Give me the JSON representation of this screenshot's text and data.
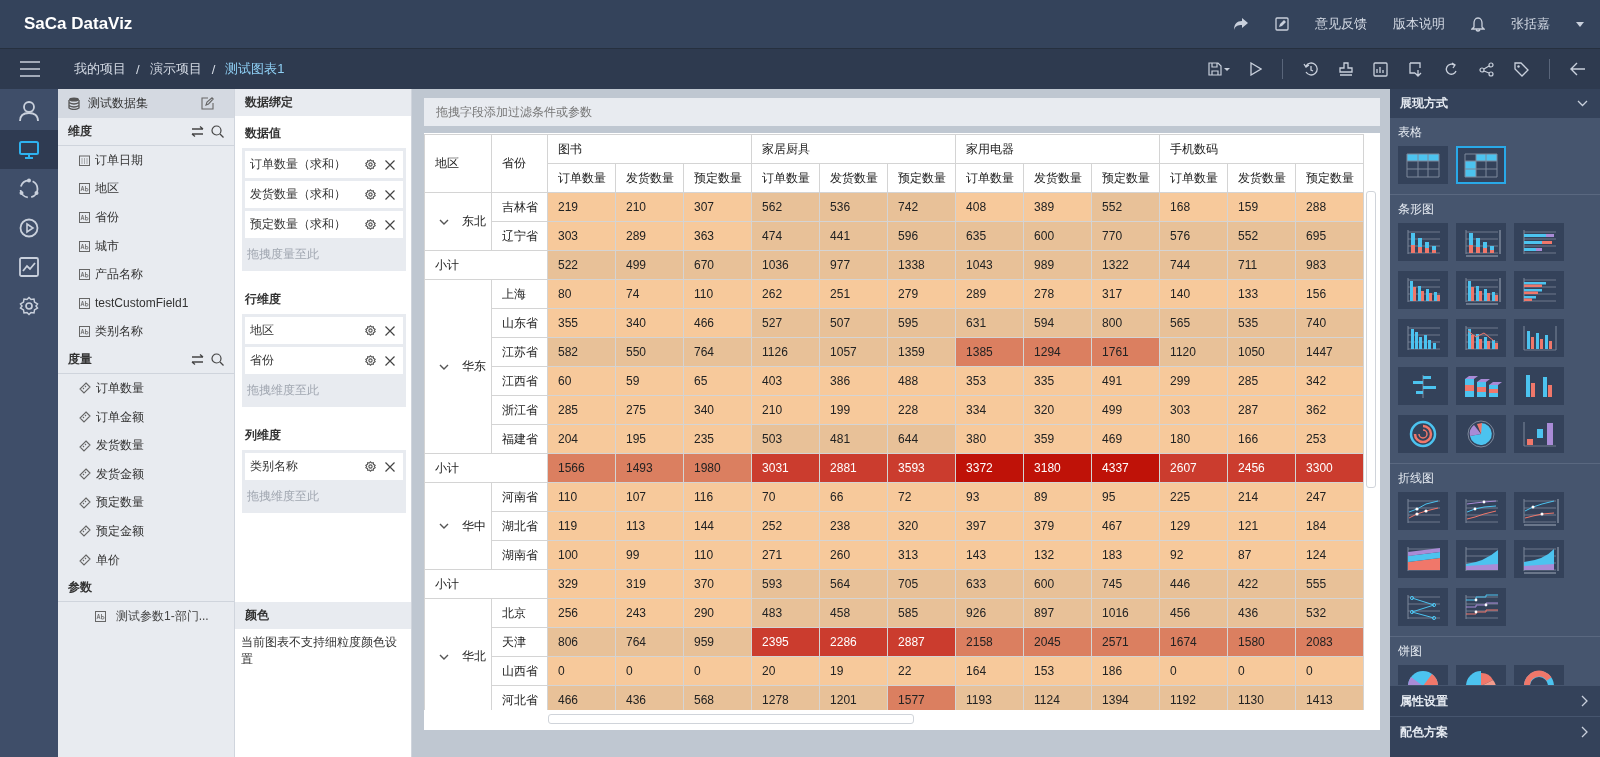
{
  "header": {
    "logo": "SaCa DataViz",
    "links": [
      "意见反馈",
      "版本说明"
    ],
    "user": "张括嘉"
  },
  "breadcrumb": {
    "separator": "/",
    "items": [
      "我的项目",
      "演示项目",
      "测试图表1"
    ]
  },
  "nav": [
    {
      "kind": "user",
      "selected": false
    },
    {
      "kind": "monitor",
      "selected": true
    },
    {
      "kind": "ring",
      "selected": false
    },
    {
      "kind": "play",
      "selected": false
    },
    {
      "kind": "chart",
      "selected": false
    },
    {
      "kind": "gear",
      "selected": false
    }
  ],
  "dataset": {
    "title": "测试数据集",
    "sections": [
      {
        "title": "维度",
        "tools": true,
        "items": [
          {
            "label": "订单日期",
            "kind": "date"
          },
          {
            "label": "地区",
            "kind": "text"
          },
          {
            "label": "省份",
            "kind": "text"
          },
          {
            "label": "城市",
            "kind": "text"
          },
          {
            "label": "产品名称",
            "kind": "text"
          },
          {
            "label": "testCustomField1",
            "kind": "text"
          },
          {
            "label": "类别名称",
            "kind": "text"
          }
        ]
      },
      {
        "title": "度量",
        "tools": true,
        "items": [
          {
            "label": "订单数量",
            "kind": "measure"
          },
          {
            "label": "订单金额",
            "kind": "measure"
          },
          {
            "label": "发货数量",
            "kind": "measure"
          },
          {
            "label": "发货金额",
            "kind": "measure"
          },
          {
            "label": "预定数量",
            "kind": "measure"
          },
          {
            "label": "预定金额",
            "kind": "measure"
          },
          {
            "label": "单价",
            "kind": "measure"
          }
        ]
      },
      {
        "title": "参数",
        "tools": false,
        "items": [
          {
            "label": "测试参数1-部门...",
            "kind": "param"
          }
        ]
      }
    ]
  },
  "binding": {
    "title": "数据绑定",
    "sections": [
      {
        "title": "数据值",
        "fields": [
          "订单数量（求和）",
          "发货数量（求和）",
          "预定数量（求和）"
        ],
        "hint": "拖拽度量至此"
      },
      {
        "title": "行维度",
        "fields": [
          "地区",
          "省份"
        ],
        "hint": "拖拽维度至此"
      },
      {
        "title": "列维度",
        "fields": [
          "类别名称"
        ],
        "hint": "拖拽维度至此"
      }
    ],
    "color": {
      "title": "颜色",
      "note": "当前图表不支持细粒度颜色设置"
    }
  },
  "filter_bar": {
    "hint": "拖拽字段添加过滤条件或参数"
  },
  "table": {
    "region_header": "地区",
    "province_header": "省份",
    "groups": [
      {
        "label": "图书",
        "measures": [
          "订单数量",
          "发货数量",
          "预定数量"
        ]
      },
      {
        "label": "家居厨具",
        "measures": [
          "订单数量",
          "发货数量",
          "预定数量"
        ]
      },
      {
        "label": "家用电器",
        "measures": [
          "订单数量",
          "发货数量",
          "预定数量"
        ]
      },
      {
        "label": "手机数码",
        "measures": [
          "订单数量",
          "发货数量",
          "预定数量"
        ]
      }
    ],
    "row_groups": [
      {
        "region": "东北",
        "expanded": true,
        "rows": [
          {
            "province": "吉林省",
            "cells": [
              {
                "value": "219",
                "color": "#f7c99b"
              },
              {
                "value": "210",
                "color": "#f7c99b"
              },
              {
                "value": "307",
                "color": "#f7c99b"
              },
              {
                "value": "562",
                "color": "#e8c198"
              },
              {
                "value": "536",
                "color": "#e8c198"
              },
              {
                "value": "742",
                "color": "#e8c198"
              },
              {
                "value": "408",
                "color": "#f7c99b"
              },
              {
                "value": "389",
                "color": "#f7c99b"
              },
              {
                "value": "552",
                "color": "#e8c198"
              },
              {
                "value": "168",
                "color": "#f7c99b"
              },
              {
                "value": "159",
                "color": "#f7c99b"
              },
              {
                "value": "288",
                "color": "#f7c99b"
              }
            ]
          },
          {
            "province": "辽宁省",
            "cells": [
              {
                "value": "303",
                "color": "#f7c99b"
              },
              {
                "value": "289",
                "color": "#f7c99b"
              },
              {
                "value": "363",
                "color": "#f7c99b"
              },
              {
                "value": "474",
                "color": "#e8c198"
              },
              {
                "value": "441",
                "color": "#e8c198"
              },
              {
                "value": "596",
                "color": "#e8c198"
              },
              {
                "value": "635",
                "color": "#e8c198"
              },
              {
                "value": "600",
                "color": "#e8c198"
              },
              {
                "value": "770",
                "color": "#e8c198"
              },
              {
                "value": "576",
                "color": "#e8c198"
              },
              {
                "value": "552",
                "color": "#e8c198"
              },
              {
                "value": "695",
                "color": "#e8c198"
              }
            ]
          }
        ],
        "subtotal": {
          "label": "小计",
          "cells": [
            {
              "value": "522",
              "color": "#e8c198"
            },
            {
              "value": "499",
              "color": "#e8c198"
            },
            {
              "value": "670",
              "color": "#e8c198"
            },
            {
              "value": "1036",
              "color": "#e8c198"
            },
            {
              "value": "977",
              "color": "#e8c198"
            },
            {
              "value": "1338",
              "color": "#e8c198"
            },
            {
              "value": "1043",
              "color": "#e8c198"
            },
            {
              "value": "989",
              "color": "#e8c198"
            },
            {
              "value": "1322",
              "color": "#e8c198"
            },
            {
              "value": "744",
              "color": "#e8c198"
            },
            {
              "value": "711",
              "color": "#e8c198"
            },
            {
              "value": "983",
              "color": "#e8c198"
            }
          ]
        }
      },
      {
        "region": "华东",
        "expanded": true,
        "rows": [
          {
            "province": "上海",
            "cells": [
              {
                "value": "80",
                "color": "#f7c99b"
              },
              {
                "value": "74",
                "color": "#f7c99b"
              },
              {
                "value": "110",
                "color": "#f7c99b"
              },
              {
                "value": "262",
                "color": "#f7c99b"
              },
              {
                "value": "251",
                "color": "#f7c99b"
              },
              {
                "value": "279",
                "color": "#f7c99b"
              },
              {
                "value": "289",
                "color": "#f7c99b"
              },
              {
                "value": "278",
                "color": "#f7c99b"
              },
              {
                "value": "317",
                "color": "#f7c99b"
              },
              {
                "value": "140",
                "color": "#f7c99b"
              },
              {
                "value": "133",
                "color": "#f7c99b"
              },
              {
                "value": "156",
                "color": "#f7c99b"
              }
            ]
          },
          {
            "province": "山东省",
            "cells": [
              {
                "value": "355",
                "color": "#f7c99b"
              },
              {
                "value": "340",
                "color": "#f7c99b"
              },
              {
                "value": "466",
                "color": "#f7c99b"
              },
              {
                "value": "527",
                "color": "#e8c198"
              },
              {
                "value": "507",
                "color": "#e8c198"
              },
              {
                "value": "595",
                "color": "#e8c198"
              },
              {
                "value": "631",
                "color": "#e8c198"
              },
              {
                "value": "594",
                "color": "#e8c198"
              },
              {
                "value": "800",
                "color": "#e8c198"
              },
              {
                "value": "565",
                "color": "#e8c198"
              },
              {
                "value": "535",
                "color": "#e8c198"
              },
              {
                "value": "740",
                "color": "#e8c198"
              }
            ]
          },
          {
            "province": "江苏省",
            "cells": [
              {
                "value": "582",
                "color": "#e8c198"
              },
              {
                "value": "550",
                "color": "#e8c198"
              },
              {
                "value": "764",
                "color": "#e8c198"
              },
              {
                "value": "1126",
                "color": "#e8c198"
              },
              {
                "value": "1057",
                "color": "#e8c198"
              },
              {
                "value": "1359",
                "color": "#e8c198"
              },
              {
                "value": "1385",
                "color": "#db7f60"
              },
              {
                "value": "1294",
                "color": "#db7f60"
              },
              {
                "value": "1761",
                "color": "#db7f60"
              },
              {
                "value": "1120",
                "color": "#e8c198"
              },
              {
                "value": "1050",
                "color": "#e8c198"
              },
              {
                "value": "1447",
                "color": "#e8c198"
              }
            ]
          },
          {
            "province": "江西省",
            "cells": [
              {
                "value": "60",
                "color": "#f7c99b"
              },
              {
                "value": "59",
                "color": "#f7c99b"
              },
              {
                "value": "65",
                "color": "#f7c99b"
              },
              {
                "value": "403",
                "color": "#f7c99b"
              },
              {
                "value": "386",
                "color": "#f7c99b"
              },
              {
                "value": "488",
                "color": "#f7c99b"
              },
              {
                "value": "353",
                "color": "#f7c99b"
              },
              {
                "value": "335",
                "color": "#f7c99b"
              },
              {
                "value": "491",
                "color": "#f7c99b"
              },
              {
                "value": "299",
                "color": "#f7c99b"
              },
              {
                "value": "285",
                "color": "#f7c99b"
              },
              {
                "value": "342",
                "color": "#f7c99b"
              }
            ]
          },
          {
            "province": "浙江省",
            "cells": [
              {
                "value": "285",
                "color": "#f7c99b"
              },
              {
                "value": "275",
                "color": "#f7c99b"
              },
              {
                "value": "340",
                "color": "#f7c99b"
              },
              {
                "value": "210",
                "color": "#f7c99b"
              },
              {
                "value": "199",
                "color": "#f7c99b"
              },
              {
                "value": "228",
                "color": "#f7c99b"
              },
              {
                "value": "334",
                "color": "#f7c99b"
              },
              {
                "value": "320",
                "color": "#f7c99b"
              },
              {
                "value": "499",
                "color": "#f7c99b"
              },
              {
                "value": "303",
                "color": "#f7c99b"
              },
              {
                "value": "287",
                "color": "#f7c99b"
              },
              {
                "value": "362",
                "color": "#f7c99b"
              }
            ]
          },
          {
            "province": "福建省",
            "cells": [
              {
                "value": "204",
                "color": "#f7c99b"
              },
              {
                "value": "195",
                "color": "#f7c99b"
              },
              {
                "value": "235",
                "color": "#f7c99b"
              },
              {
                "value": "503",
                "color": "#e8c198"
              },
              {
                "value": "481",
                "color": "#e8c198"
              },
              {
                "value": "644",
                "color": "#e8c198"
              },
              {
                "value": "380",
                "color": "#f7c99b"
              },
              {
                "value": "359",
                "color": "#f7c99b"
              },
              {
                "value": "469",
                "color": "#f7c99b"
              },
              {
                "value": "180",
                "color": "#f7c99b"
              },
              {
                "value": "166",
                "color": "#f7c99b"
              },
              {
                "value": "253",
                "color": "#f7c99b"
              }
            ]
          }
        ],
        "subtotal": {
          "label": "小计",
          "cells": [
            {
              "value": "1566",
              "color": "#db7f60"
            },
            {
              "value": "1493",
              "color": "#db7f60"
            },
            {
              "value": "1980",
              "color": "#db7f60"
            },
            {
              "value": "3031",
              "color": "#cb3c2e"
            },
            {
              "value": "2881",
              "color": "#cb3c2e"
            },
            {
              "value": "3593",
              "color": "#cb3c2e"
            },
            {
              "value": "3372",
              "color": "#bf1208"
            },
            {
              "value": "3180",
              "color": "#bf1208"
            },
            {
              "value": "4337",
              "color": "#bf1208"
            },
            {
              "value": "2607",
              "color": "#cb3c2e"
            },
            {
              "value": "2456",
              "color": "#cb3c2e"
            },
            {
              "value": "3300",
              "color": "#cb3c2e"
            }
          ]
        }
      },
      {
        "region": "华中",
        "expanded": true,
        "rows": [
          {
            "province": "河南省",
            "cells": [
              {
                "value": "110",
                "color": "#f7c99b"
              },
              {
                "value": "107",
                "color": "#f7c99b"
              },
              {
                "value": "116",
                "color": "#f7c99b"
              },
              {
                "value": "70",
                "color": "#f7c99b"
              },
              {
                "value": "66",
                "color": "#f7c99b"
              },
              {
                "value": "72",
                "color": "#f7c99b"
              },
              {
                "value": "93",
                "color": "#f7c99b"
              },
              {
                "value": "89",
                "color": "#f7c99b"
              },
              {
                "value": "95",
                "color": "#f7c99b"
              },
              {
                "value": "225",
                "color": "#f7c99b"
              },
              {
                "value": "214",
                "color": "#f7c99b"
              },
              {
                "value": "247",
                "color": "#f7c99b"
              }
            ]
          },
          {
            "province": "湖北省",
            "cells": [
              {
                "value": "119",
                "color": "#f7c99b"
              },
              {
                "value": "113",
                "color": "#f7c99b"
              },
              {
                "value": "144",
                "color": "#f7c99b"
              },
              {
                "value": "252",
                "color": "#f7c99b"
              },
              {
                "value": "238",
                "color": "#f7c99b"
              },
              {
                "value": "320",
                "color": "#f7c99b"
              },
              {
                "value": "397",
                "color": "#f7c99b"
              },
              {
                "value": "379",
                "color": "#f7c99b"
              },
              {
                "value": "467",
                "color": "#f7c99b"
              },
              {
                "value": "129",
                "color": "#f7c99b"
              },
              {
                "value": "121",
                "color": "#f7c99b"
              },
              {
                "value": "184",
                "color": "#f7c99b"
              }
            ]
          },
          {
            "province": "湖南省",
            "cells": [
              {
                "value": "100",
                "color": "#f7c99b"
              },
              {
                "value": "99",
                "color": "#f7c99b"
              },
              {
                "value": "110",
                "color": "#f7c99b"
              },
              {
                "value": "271",
                "color": "#f7c99b"
              },
              {
                "value": "260",
                "color": "#f7c99b"
              },
              {
                "value": "313",
                "color": "#f7c99b"
              },
              {
                "value": "143",
                "color": "#f7c99b"
              },
              {
                "value": "132",
                "color": "#f7c99b"
              },
              {
                "value": "183",
                "color": "#f7c99b"
              },
              {
                "value": "92",
                "color": "#f7c99b"
              },
              {
                "value": "87",
                "color": "#f7c99b"
              },
              {
                "value": "124",
                "color": "#f7c99b"
              }
            ]
          }
        ],
        "subtotal": {
          "label": "小计",
          "cells": [
            {
              "value": "329",
              "color": "#f7c99b"
            },
            {
              "value": "319",
              "color": "#f7c99b"
            },
            {
              "value": "370",
              "color": "#f7c99b"
            },
            {
              "value": "593",
              "color": "#e8c198"
            },
            {
              "value": "564",
              "color": "#e8c198"
            },
            {
              "value": "705",
              "color": "#e8c198"
            },
            {
              "value": "633",
              "color": "#e8c198"
            },
            {
              "value": "600",
              "color": "#e8c198"
            },
            {
              "value": "745",
              "color": "#e8c198"
            },
            {
              "value": "446",
              "color": "#e8c198"
            },
            {
              "value": "422",
              "color": "#e8c198"
            },
            {
              "value": "555",
              "color": "#e8c198"
            }
          ]
        }
      },
      {
        "region": "华北",
        "expanded": true,
        "rows": [
          {
            "province": "北京",
            "cells": [
              {
                "value": "256",
                "color": "#f7c99b"
              },
              {
                "value": "243",
                "color": "#f7c99b"
              },
              {
                "value": "290",
                "color": "#f7c99b"
              },
              {
                "value": "483",
                "color": "#e8c198"
              },
              {
                "value": "458",
                "color": "#e8c198"
              },
              {
                "value": "585",
                "color": "#e8c198"
              },
              {
                "value": "926",
                "color": "#e8c198"
              },
              {
                "value": "897",
                "color": "#e8c198"
              },
              {
                "value": "1016",
                "color": "#e8c198"
              },
              {
                "value": "456",
                "color": "#e8c198"
              },
              {
                "value": "436",
                "color": "#e8c198"
              },
              {
                "value": "532",
                "color": "#e8c198"
              }
            ]
          },
          {
            "province": "天津",
            "cells": [
              {
                "value": "806",
                "color": "#e8c198"
              },
              {
                "value": "764",
                "color": "#e8c198"
              },
              {
                "value": "959",
                "color": "#e8c198"
              },
              {
                "value": "2395",
                "color": "#cb3c2e"
              },
              {
                "value": "2286",
                "color": "#cb3c2e"
              },
              {
                "value": "2887",
                "color": "#cb3c2e"
              },
              {
                "value": "2158",
                "color": "#db7f60"
              },
              {
                "value": "2045",
                "color": "#db7f60"
              },
              {
                "value": "2571",
                "color": "#db7f60"
              },
              {
                "value": "1674",
                "color": "#db7f60"
              },
              {
                "value": "1580",
                "color": "#db7f60"
              },
              {
                "value": "2083",
                "color": "#db7f60"
              }
            ]
          },
          {
            "province": "山西省",
            "cells": [
              {
                "value": "0",
                "color": "#f7c99b"
              },
              {
                "value": "0",
                "color": "#f7c99b"
              },
              {
                "value": "0",
                "color": "#f7c99b"
              },
              {
                "value": "20",
                "color": "#f7c99b"
              },
              {
                "value": "19",
                "color": "#f7c99b"
              },
              {
                "value": "22",
                "color": "#f7c99b"
              },
              {
                "value": "164",
                "color": "#f7c99b"
              },
              {
                "value": "153",
                "color": "#f7c99b"
              },
              {
                "value": "186",
                "color": "#f7c99b"
              },
              {
                "value": "0",
                "color": "#f7c99b"
              },
              {
                "value": "0",
                "color": "#f7c99b"
              },
              {
                "value": "0",
                "color": "#f7c99b"
              }
            ]
          },
          {
            "province": "河北省",
            "cells": [
              {
                "value": "466",
                "color": "#e8c198"
              },
              {
                "value": "436",
                "color": "#e8c198"
              },
              {
                "value": "568",
                "color": "#e8c198"
              },
              {
                "value": "1278",
                "color": "#e8c198"
              },
              {
                "value": "1201",
                "color": "#e8c198"
              },
              {
                "value": "1577",
                "color": "#db7f60"
              },
              {
                "value": "1193",
                "color": "#e8c198"
              },
              {
                "value": "1124",
                "color": "#e8c198"
              },
              {
                "value": "1394",
                "color": "#e8c198"
              },
              {
                "value": "1192",
                "color": "#e8c198"
              },
              {
                "value": "1130",
                "color": "#e8c198"
              },
              {
                "value": "1413",
                "color": "#e8c198"
              }
            ]
          }
        ]
      }
    ]
  },
  "display_panel": {
    "title": "展现方式",
    "expanded": true,
    "categories": [
      {
        "title": "表格",
        "charts": [
          {
            "kind": "table-plain",
            "selected": false
          },
          {
            "kind": "table-cross",
            "selected": true
          }
        ]
      },
      {
        "title": "条形图",
        "charts": [
          {
            "kind": "bar-stacked",
            "selected": false
          },
          {
            "kind": "bar-stacked-dual",
            "selected": false
          },
          {
            "kind": "hbar-stacked",
            "selected": false
          },
          {
            "kind": "bar-grouped",
            "selected": false
          },
          {
            "kind": "bar-grouped-dual",
            "selected": false
          },
          {
            "kind": "hbar-grouped",
            "selected": false
          },
          {
            "kind": "bar-multi",
            "selected": false
          },
          {
            "kind": "bar-line",
            "selected": false
          },
          {
            "kind": "bar-axis",
            "selected": false
          },
          {
            "kind": "hbar-diverging",
            "selected": false
          },
          {
            "kind": "bar-3d-stacked",
            "selected": false
          },
          {
            "kind": "bar-3d",
            "selected": false
          },
          {
            "kind": "ring",
            "selected": false
          },
          {
            "kind": "polar-pie",
            "selected": false
          },
          {
            "kind": "waterfall",
            "selected": false
          }
        ]
      },
      {
        "title": "折线图",
        "charts": [
          {
            "kind": "line",
            "selected": false
          },
          {
            "kind": "line-multi",
            "selected": false
          },
          {
            "kind": "line-dual",
            "selected": false
          },
          {
            "kind": "area-stacked",
            "selected": false
          },
          {
            "kind": "area",
            "selected": false
          },
          {
            "kind": "area-dual",
            "selected": false
          },
          {
            "kind": "line-zigzag",
            "selected": false
          },
          {
            "kind": "line-step",
            "selected": false
          }
        ]
      },
      {
        "title": "饼图",
        "charts": [
          {
            "kind": "pie",
            "selected": false
          },
          {
            "kind": "pie-rose",
            "selected": false
          },
          {
            "kind": "donut",
            "selected": false
          }
        ]
      }
    ]
  },
  "settings": [
    "属性设置",
    "配色方案"
  ]
}
